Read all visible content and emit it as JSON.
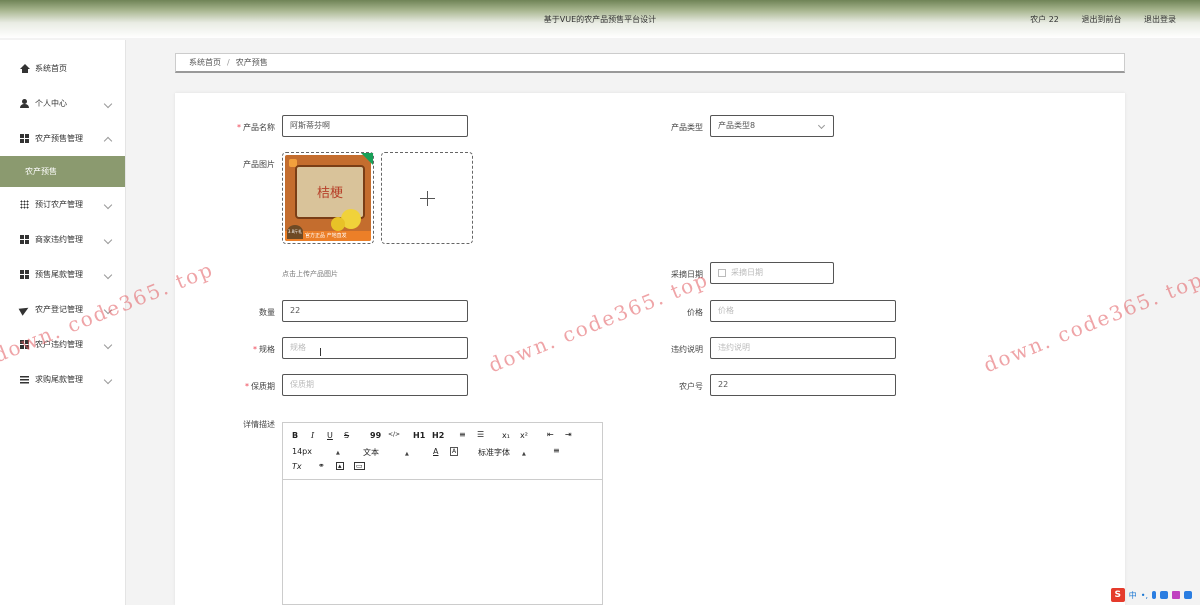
{
  "header": {
    "title": "基于VUE的农产品预售平台设计",
    "user": "农户 22",
    "back_to_front": "退出到前台",
    "logout": "退出登录"
  },
  "sidebar": {
    "items": [
      {
        "label": "系统首页",
        "icon": "home-icon"
      },
      {
        "label": "个人中心",
        "icon": "user-icon"
      },
      {
        "label": "农产预售管理",
        "icon": "grid-icon"
      },
      {
        "label": "预订农产管理",
        "icon": "grid9-icon"
      },
      {
        "label": "商家违约管理",
        "icon": "grid-icon"
      },
      {
        "label": "预售尾款管理",
        "icon": "grid-icon"
      },
      {
        "label": "农产登记管理",
        "icon": "send-icon"
      },
      {
        "label": "农户违约管理",
        "icon": "grid-icon"
      },
      {
        "label": "求购尾款管理",
        "icon": "list-icon"
      }
    ],
    "active_sub": "农产预售"
  },
  "breadcrumb": {
    "home": "系统首页",
    "separator": "/",
    "current": "农产预售"
  },
  "form": {
    "product_name": {
      "label": "产品名称",
      "value": "阿斯蒂芬啊"
    },
    "product_type": {
      "label": "产品类型",
      "value": "产品类型8"
    },
    "product_image": {
      "label": "产品图片",
      "hint": "点击上传产品图片",
      "plus": "+"
    },
    "pick_date": {
      "label": "采摘日期",
      "placeholder": "采摘日期"
    },
    "quantity": {
      "label": "数量",
      "value": "22"
    },
    "price": {
      "label": "价格",
      "placeholder": "价格"
    },
    "spec": {
      "label": "规格",
      "placeholder": "规格"
    },
    "breach": {
      "label": "违约说明",
      "placeholder": "违约说明"
    },
    "shelf_life": {
      "label": "保质期",
      "placeholder": "保质期"
    },
    "farmer_no": {
      "label": "农户号",
      "value": "22"
    },
    "detail": {
      "label": "详情描述"
    },
    "required_mark": "*"
  },
  "thumb": {
    "board_text": "桔梗",
    "strip_text": "官方正品 产地直发",
    "badge_text": "3.8斤礼盒装 XL果"
  },
  "editor": {
    "row1": [
      "B",
      "I",
      "U",
      "S",
      "99",
      "</>",
      "H1",
      "H2",
      "≡",
      "☰",
      "x₁",
      "x²",
      "⇤",
      "⇥"
    ],
    "font_size": "14px",
    "text_type": "文本",
    "font_family": "标准字体",
    "clear": "Tx"
  },
  "watermark": {
    "text": "down. code365. top"
  },
  "tray": {
    "logo": "S",
    "lang": "中",
    "punct": "•,"
  },
  "colors": {
    "accent": "#8b9a6f",
    "required": "#e45555",
    "watermark": "#e15a5f"
  }
}
